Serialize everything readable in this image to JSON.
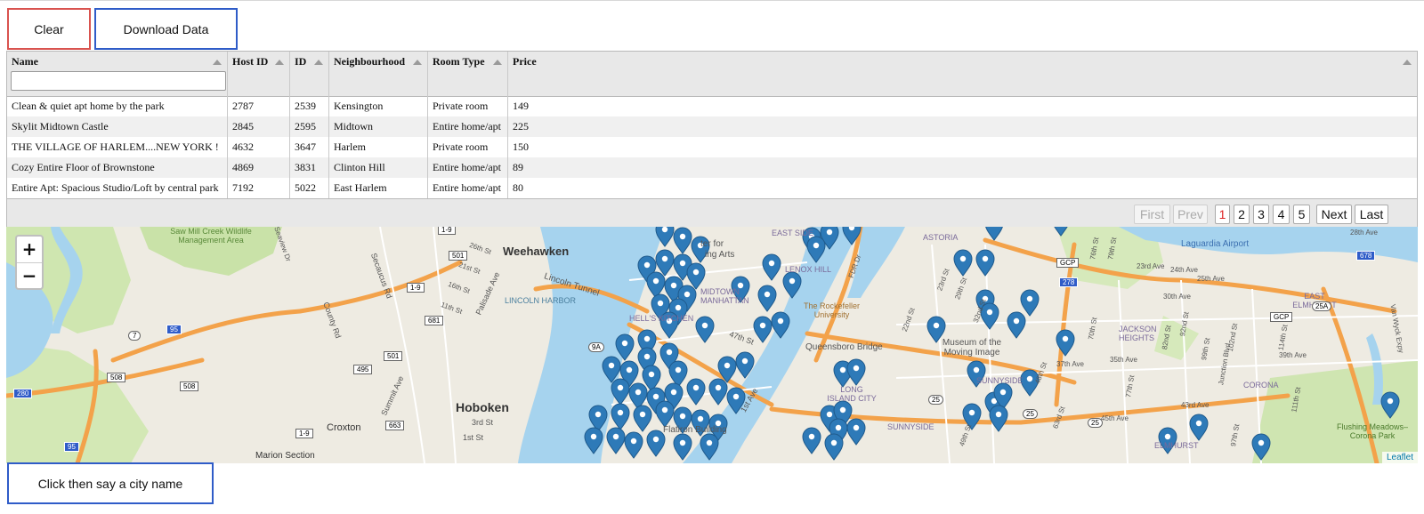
{
  "toolbar": {
    "clear_label": "Clear",
    "download_label": "Download Data"
  },
  "voice_button_label": "Click then say a city name",
  "table": {
    "columns": [
      "Name",
      "Host ID",
      "ID",
      "Neighbourhood",
      "Room Type",
      "Price"
    ],
    "filter_placeholder": "",
    "rows": [
      [
        "Clean & quiet apt home by the park",
        "2787",
        "2539",
        "Kensington",
        "Private room",
        "149"
      ],
      [
        "Skylit Midtown Castle",
        "2845",
        "2595",
        "Midtown",
        "Entire home/apt",
        "225"
      ],
      [
        "THE VILLAGE OF HARLEM....NEW YORK !",
        "4632",
        "3647",
        "Harlem",
        "Private room",
        "150"
      ],
      [
        "Cozy Entire Floor of Brownstone",
        "4869",
        "3831",
        "Clinton Hill",
        "Entire home/apt",
        "89"
      ],
      [
        "Entire Apt: Spacious Studio/Loft by central park",
        "7192",
        "5022",
        "East Harlem",
        "Entire home/apt",
        "80"
      ]
    ]
  },
  "pager": {
    "first": "First",
    "prev": "Prev",
    "pages": [
      "1",
      "2",
      "3",
      "4",
      "5"
    ],
    "active_page": "1",
    "next": "Next",
    "last": "Last"
  },
  "map": {
    "zoom_in": "+",
    "zoom_out": "−",
    "attribution": "Leaflet",
    "marker_color": "#2e7ab8",
    "water_color": "#a6d3ee",
    "road_color": "#f3a24a",
    "labels": {
      "weehawken": "Weehawken",
      "hoboken": "Hoboken",
      "lincoln_harbor": "LINCOLN HARBOR",
      "lincoln_tunnel": "Lincoln Tunnel",
      "saw_mill": "Saw Mill Creek Wildlife Management Area",
      "secaucus_rd": "Secaucus Rd",
      "county_rd": "County Rd",
      "summit_ave": "Summit Ave",
      "palisade_ave": "Palisade Ave",
      "croxton": "Croxton",
      "marion": "Marion Section",
      "midtown_manhattan": "MIDTOWN MANHATTAN",
      "hells_kitchen": "HELL'S KITCHEN",
      "lenox_hill": "LENOX HILL",
      "east_side": "EAST SIDE",
      "rockefeller": "The Rockefeller University",
      "queensboro": "Queensboro Bridge",
      "lic": "LONG ISLAND CITY",
      "astoria": "ASTORIA",
      "sunnyside": "SUNNYSIDE",
      "sunnyside2": "SUNNYSIDE",
      "museum": "Museum of the Moving Image",
      "jackson_heights": "JACKSON HEIGHTS",
      "east_elmhurst": "EAST ELMHURST",
      "corona": "CORONA",
      "elmhurst": "ELMHURST",
      "laguardia": "Laguardia Airport",
      "flushing": "Flushing Meadows–Corona Park",
      "flatiron": "Flatiron Building",
      "ter_for": "ter for",
      "ing_arts": "ing Arts",
      "st_47": "47th St",
      "ave_1st": "1st Ave",
      "st_26": "26th St",
      "st_21": "21st St",
      "st_16": "16th St",
      "st_11": "11th St",
      "st_3": "3rd St",
      "st_1": "1st St",
      "ave_37": "37th Ave",
      "ave_35": "35th Ave",
      "ave_39": "39th Ave",
      "ave_45": "45th Ave",
      "ave_43": "43rd Ave",
      "ave_30": "30th Ave",
      "ave_23": "23rd Ave",
      "ave_24": "24th Ave",
      "ave_25": "25th Ave",
      "ave_28": "28th Ave",
      "st_76": "76th St",
      "st_79": "79th St",
      "st_82": "82nd St",
      "st_92": "92nd St",
      "st_99": "99th St",
      "st_102": "102nd St",
      "st_114": "114th St",
      "st_111": "111th St",
      "st_97": "97th St",
      "st_70": "70th St",
      "st_77": "77th St",
      "st_63": "63rd St",
      "st_48": "48th St",
      "st_49": "49th St",
      "st_29": "29th St",
      "st_23": "23rd St",
      "st_22": "22nd St",
      "st_32": "32nd St",
      "junction": "Junction Blvd",
      "van_wyck": "Van Wyck Expy",
      "fdr": "FDR Dr",
      "seaview": "Seaview Dr"
    },
    "shields": [
      "1-9",
      "501",
      "681",
      "495",
      "1-9",
      "501",
      "663",
      "1-9",
      "508",
      "508",
      "95",
      "280",
      "95",
      "7",
      "9A",
      "1-9",
      "25",
      "25",
      "25",
      "278",
      "GCP",
      "GCP",
      "25A",
      "678"
    ]
  }
}
